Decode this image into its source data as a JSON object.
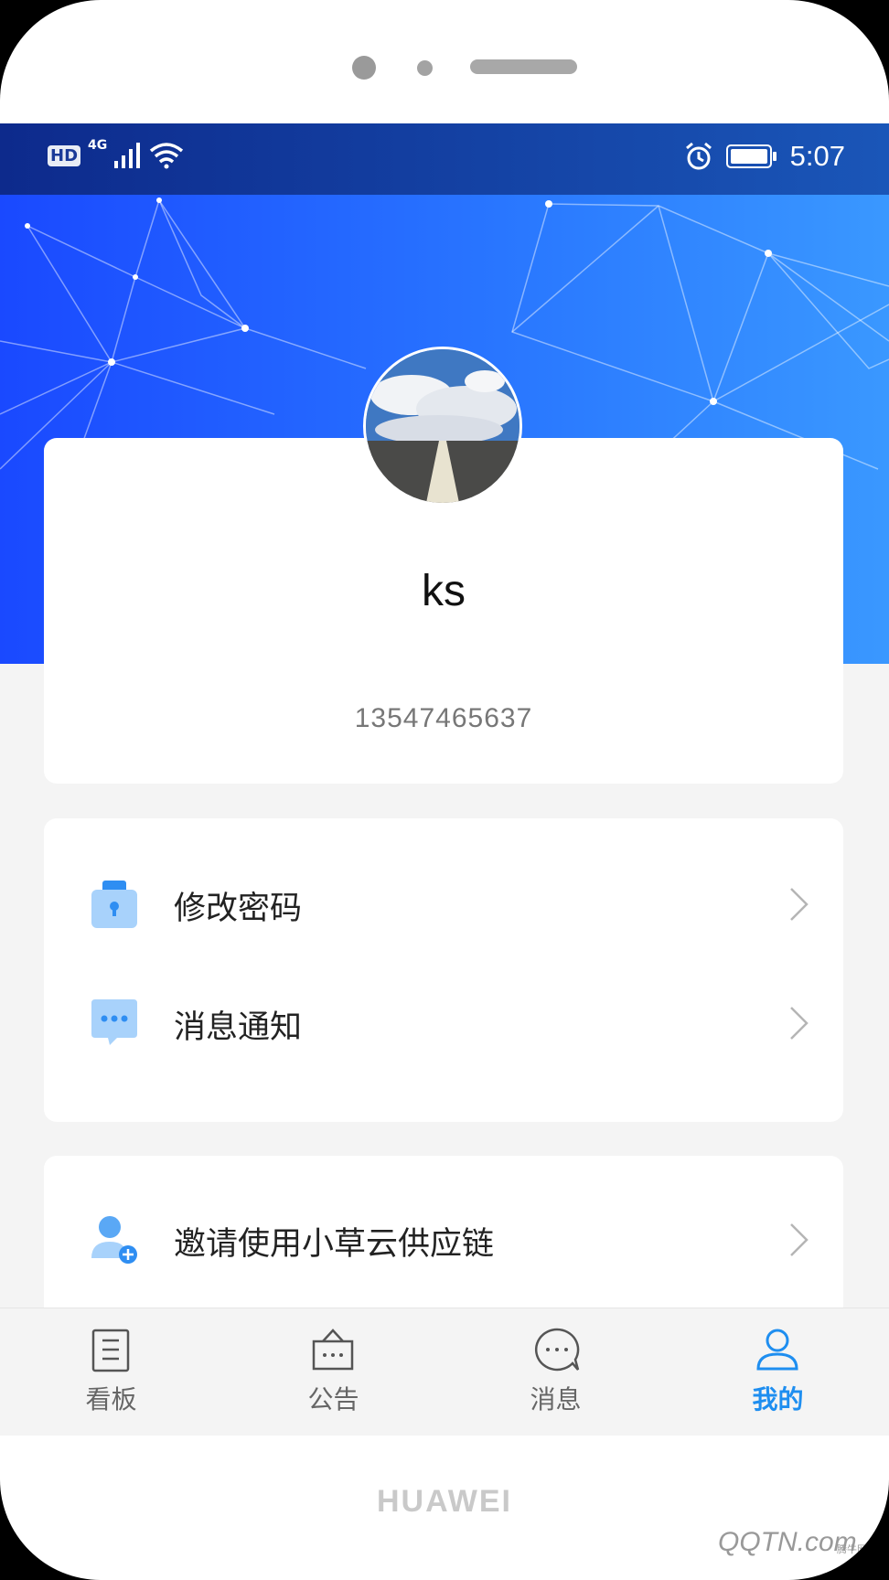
{
  "device": {
    "brand": "HUAWEI"
  },
  "status_bar": {
    "network": "4G",
    "hd_badge": "HD",
    "time": "5:07"
  },
  "profile": {
    "username": "ks",
    "phone": "13547465637"
  },
  "menu_group1": [
    {
      "label": "修改密码",
      "icon": "lock-icon"
    },
    {
      "label": "消息通知",
      "icon": "message-icon"
    }
  ],
  "menu_group2": [
    {
      "label": "邀请使用小草云供应链",
      "icon": "invite-user-icon"
    }
  ],
  "tabbar": [
    {
      "label": "看板",
      "icon": "dashboard-icon",
      "active": false
    },
    {
      "label": "公告",
      "icon": "announcement-icon",
      "active": false
    },
    {
      "label": "消息",
      "icon": "chat-icon",
      "active": false
    },
    {
      "label": "我的",
      "icon": "user-icon",
      "active": true
    }
  ],
  "watermark": {
    "text": "QQTN.com",
    "small": "腾牛网"
  },
  "colors": {
    "accent": "#1e8ef0",
    "banner_start": "#1a49ff",
    "banner_end": "#3a98ff"
  }
}
